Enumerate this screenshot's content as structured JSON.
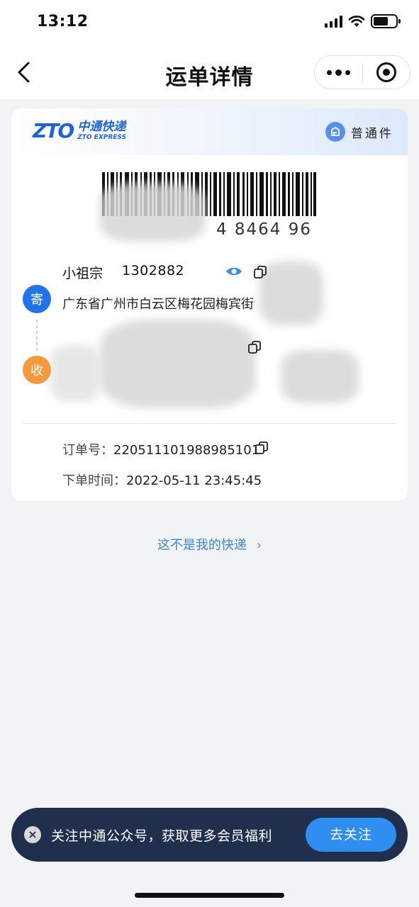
{
  "status_bar": {
    "time": "13:12"
  },
  "nav": {
    "title": "运单详情"
  },
  "card": {
    "brand": {
      "mark": "ZTO",
      "name_cn": "中通快递",
      "name_en": "ZTO EXPRESS"
    },
    "parcel_type": "普通件",
    "tracking_number_visible": "4 8464 96",
    "sender": {
      "badge": "寄",
      "name": "小祖宗",
      "phone": "1302882",
      "address": "广东省广州市白云区梅花园梅宾街"
    },
    "receiver": {
      "badge": "收"
    },
    "order": {
      "order_no_label": "订单号：",
      "order_no": "220511101988985101",
      "time_label": "下单时间：",
      "time": "2022-05-11 23:45:45"
    }
  },
  "not_mine_link": "这不是我的快递",
  "follow_banner": {
    "text": "关注中通公众号，获取更多会员福利",
    "button": "去关注"
  },
  "colors": {
    "accent": "#2173ea",
    "brand": "#1f62d6",
    "receiver": "#f29a3c",
    "banner_bg": "#1f2f4d",
    "banner_button": "#2f8ef2",
    "link": "#3a86d8"
  }
}
